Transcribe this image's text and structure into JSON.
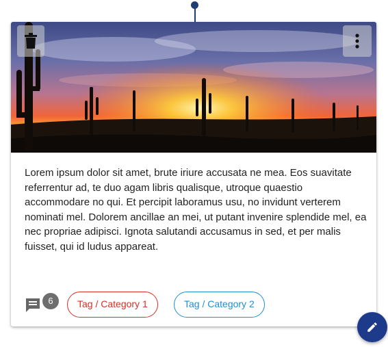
{
  "card": {
    "image_alt": "Desert sunset with saguaro cacti",
    "delete_icon": "trash-icon",
    "menu_icon": "more-vertical-icon",
    "body": "Lorem ipsum dolor sit amet, brute iriure accusata ne mea. Eos suavitate referrentur ad, te duo agam libris qualisque, utroque quaestio accommodare no qui. Et percipit laboramus usu, no invidunt verterem nominati mel. Dolorem ancillae an mei, ut putant invenire splendide mel, ea nec propriae adipisci. Ignota salutandi accusamus in sed, et per malis fuisset, qui id ludus appareat.",
    "comments": {
      "icon": "comment-icon",
      "count": "6"
    },
    "tags": [
      {
        "label": "Tag / Category 1",
        "color": "#d93025"
      },
      {
        "label": "Tag / Category 2",
        "color": "#1f8fd1"
      }
    ]
  },
  "fab": {
    "icon": "pencil-icon",
    "color": "#1e3a8a"
  },
  "connector": {
    "color": "#1f3c73"
  }
}
